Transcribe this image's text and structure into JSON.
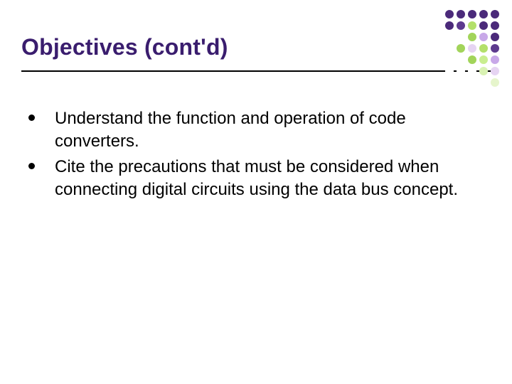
{
  "slide": {
    "title": "Objectives (cont'd)",
    "bullets": [
      "Understand the function and operation of code converters.",
      "Cite the precautions that must be considered when connecting digital circuits using the data bus concept."
    ]
  },
  "decoration": {
    "dots": [
      {
        "c": "#4b2a7a"
      },
      {
        "c": "#4b2a7a"
      },
      {
        "c": "#4b2a7a"
      },
      {
        "c": "#4b2a7a"
      },
      {
        "c": "#4b2a7a"
      },
      {
        "c": "#4b2a7a"
      },
      {
        "c": "#5d3a8e"
      },
      {
        "c": "#b3e06a"
      },
      {
        "c": "#4b2a7a"
      },
      {
        "c": "#4b2a7a"
      },
      {
        "c": "#ffffff"
      },
      {
        "c": "#ffffff"
      },
      {
        "c": "#a2d45a"
      },
      {
        "c": "#c8a8e8"
      },
      {
        "c": "#4b2a7a"
      },
      {
        "c": "#ffffff"
      },
      {
        "c": "#a2d45a"
      },
      {
        "c": "#e6d4f2"
      },
      {
        "c": "#b3e06a"
      },
      {
        "c": "#5d3a8e"
      },
      {
        "c": "#ffffff"
      },
      {
        "c": "#ffffff"
      },
      {
        "c": "#a2d45a"
      },
      {
        "c": "#c9ee8f"
      },
      {
        "c": "#c8a8e8"
      },
      {
        "c": "#ffffff"
      },
      {
        "c": "#ffffff"
      },
      {
        "c": "#ffffff"
      },
      {
        "c": "#d9f2b3"
      },
      {
        "c": "#e6d4f2"
      },
      {
        "c": "#ffffff"
      },
      {
        "c": "#ffffff"
      },
      {
        "c": "#ffffff"
      },
      {
        "c": "#ffffff"
      },
      {
        "c": "#e6f5cc"
      }
    ]
  }
}
